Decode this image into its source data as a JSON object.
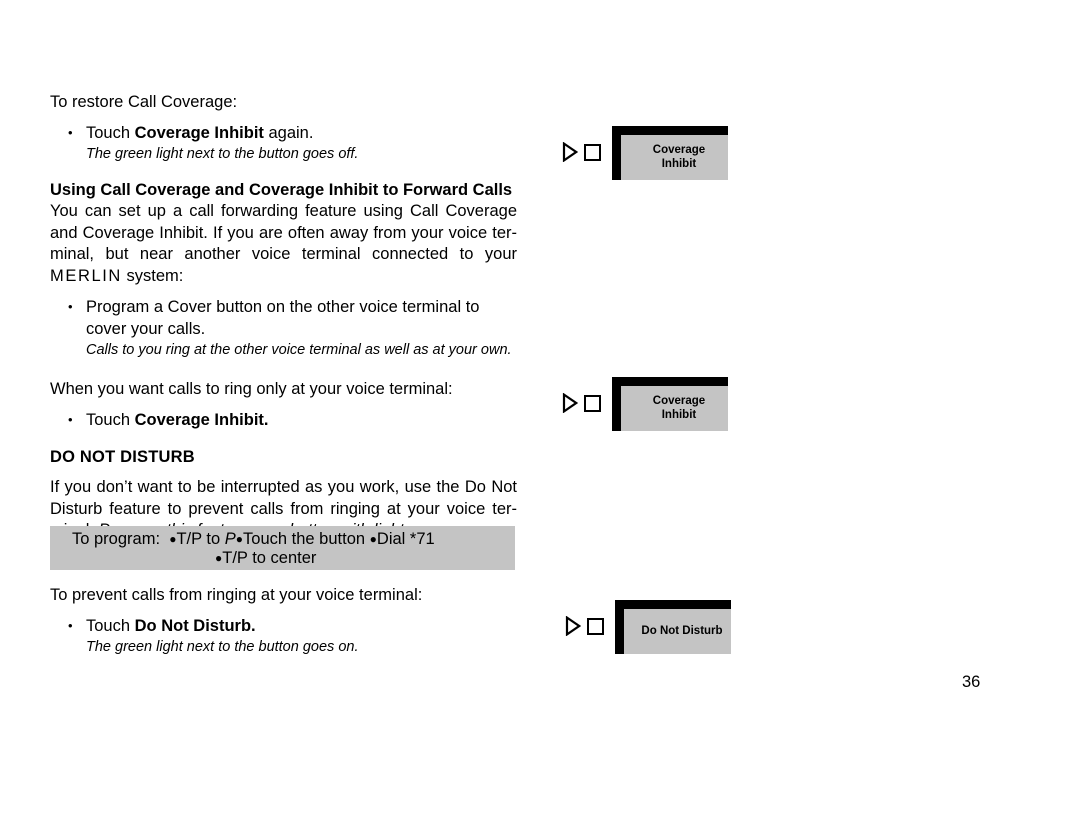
{
  "page": {
    "number": "36"
  },
  "content": {
    "restore_lead": "To restore Call Coverage:",
    "restore_bullet_pre": "Touch ",
    "restore_bullet_bold": "Coverage Inhibit",
    "restore_bullet_post": " again.",
    "restore_note": "The green light next to the button goes off.",
    "forward_heading": "Using Call Coverage and Coverage Inhibit to Forward Calls",
    "forward_para_1": "You can set up a call forwarding feature using Call Coverage and Coverage Inhibit. If you are often away from your voice ter-minal, but near another voice terminal connected to your ",
    "forward_para_merlin": "MERLIN",
    "forward_para_2": " system:",
    "forward_bullet": "Program a Cover button on the other voice terminal to cover your calls.",
    "forward_note": "Calls to you ring at the other voice terminal as well as at your own.",
    "ringonly_lead": "When you want calls to ring only at your voice terminal:",
    "ringonly_bullet_pre": "Touch ",
    "ringonly_bullet_bold": "Coverage Inhibit.",
    "dnd_heading": "DO NOT DISTURB",
    "dnd_para_plain": "If you don’t want to be interrupted as you work, use the Do Not Disturb feature to prevent calls from ringing at your voice ter-minal. ",
    "dnd_para_italic": "Program this feature on a button with lights.",
    "program_box": {
      "prefix": "To program:",
      "step1": "T/P to",
      "step1_italic": "P",
      "step2": "Touch the button",
      "step3": "Dial *71",
      "step4": "T/P to center",
      "bullet_glyph": "●"
    },
    "prevent_lead": "To prevent calls from ringing at your voice terminal:",
    "prevent_bullet_pre": "Touch ",
    "prevent_bullet_bold": "Do Not Disturb.",
    "prevent_note": "The green light next to the button goes on."
  },
  "graphics": [
    {
      "label_line1": "Coverage",
      "label_line2": "Inhibit"
    },
    {
      "label_line1": "Coverage",
      "label_line2": "Inhibit"
    },
    {
      "label_line1": "Do Not Disturb",
      "label_line2": ""
    }
  ],
  "bullet_glyph": "•",
  "colors": {
    "button_gray": "#c4c4c4",
    "box_gray": "#c4c4c4",
    "text": "#000000",
    "page_background": "#ffffff"
  }
}
